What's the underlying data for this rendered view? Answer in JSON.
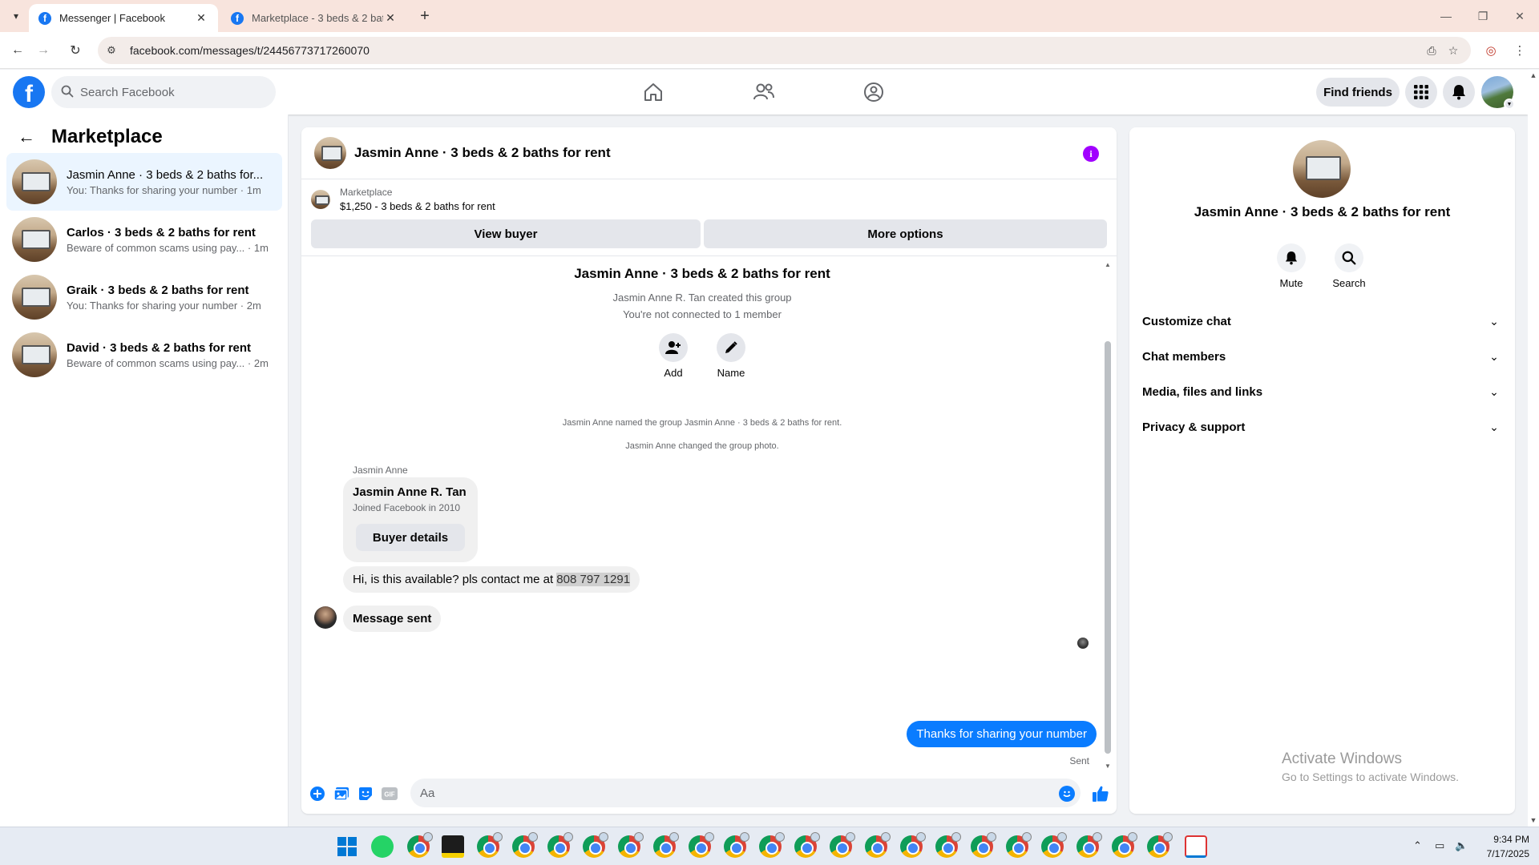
{
  "browser": {
    "tabs": [
      {
        "title": "Messenger | Facebook",
        "active": true
      },
      {
        "title": "Marketplace - 3 beds & 2 baths",
        "active": false
      }
    ],
    "url": "facebook.com/messages/t/24456773717260070"
  },
  "fb": {
    "search_placeholder": "Search Facebook",
    "find_friends_label": "Find friends"
  },
  "sidebar": {
    "title": "Marketplace",
    "conversations": [
      {
        "title": "Jasmin Anne · 3 beds & 2 baths for...",
        "subtitle": "You: Thanks for sharing your number · 1m",
        "active": true
      },
      {
        "title": "Carlos · 3 beds & 2 baths for rent",
        "subtitle": "Beware of common scams using pay... · 1m",
        "active": false
      },
      {
        "title": "Graik · 3 beds & 2 baths for rent",
        "subtitle": "You: Thanks for sharing your number · 2m",
        "active": false
      },
      {
        "title": "David · 3 beds & 2 baths for rent",
        "subtitle": "Beware of common scams using pay... · 2m",
        "active": false
      }
    ]
  },
  "chat": {
    "title": "Jasmin Anne · 3 beds & 2 baths for rent",
    "marketplace_label": "Marketplace",
    "listing": "$1,250 - 3 beds & 2 baths for rent",
    "view_buyer_label": "View buyer",
    "more_options_label": "More options",
    "group_title": "Jasmin Anne · 3 beds & 2 baths for rent",
    "group_created": "Jasmin Anne R. Tan created this group",
    "group_connection": "You're not connected to 1 member",
    "add_label": "Add",
    "name_label": "Name",
    "system_named": "Jasmin Anne named the group Jasmin Anne · 3 beds & 2 baths for rent.",
    "system_photo": "Jasmin Anne changed the group photo.",
    "sender_name": "Jasmin Anne",
    "card_name": "Jasmin Anne R. Tan",
    "card_joined": "Joined Facebook in 2010",
    "buyer_details_label": "Buyer details",
    "msg_available_prefix": "Hi, is this available? pls contact me at ",
    "msg_phone": "808 797 1291",
    "msg_sent": "Message sent",
    "msg_out": "Thanks for sharing your number",
    "sent_status": "Sent",
    "composer_placeholder": "Aa"
  },
  "rpanel": {
    "name": "Jasmin Anne · 3 beds & 2 baths for rent",
    "mute_label": "Mute",
    "search_label": "Search",
    "sections": [
      "Customize chat",
      "Chat members",
      "Media, files and links",
      "Privacy & support"
    ]
  },
  "watermark": {
    "line1": "Activate Windows",
    "line2": "Go to Settings to activate Windows."
  },
  "clock": {
    "time": "9:34 PM",
    "date": "7/17/2025"
  },
  "colors": {
    "fb_blue": "#1877f2",
    "messenger_blue": "#0a7cff",
    "info_purple": "#a100ff",
    "active_conversation_bg": "#ebf5ff"
  }
}
